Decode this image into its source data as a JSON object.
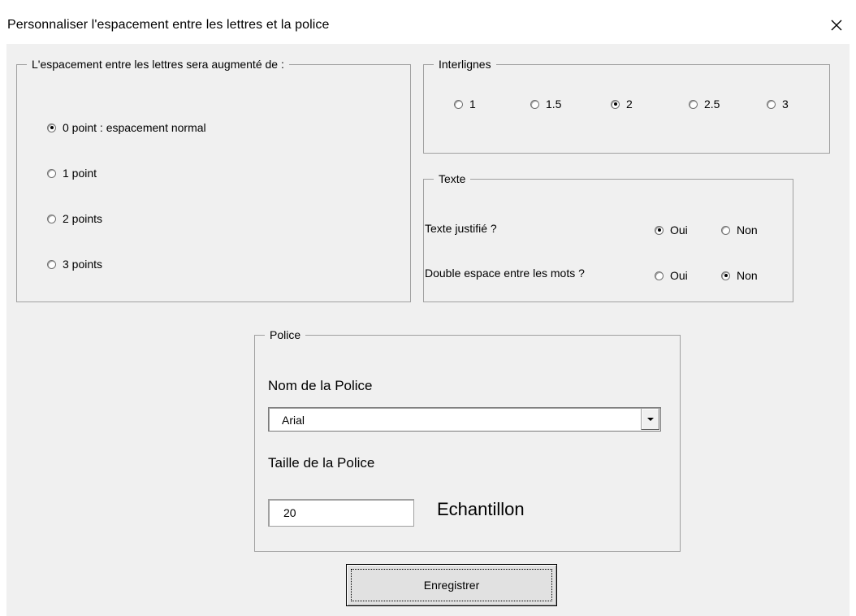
{
  "window": {
    "title": "Personnaliser l'espacement entre les lettres et la police",
    "close_icon": "close-icon"
  },
  "letter_spacing": {
    "legend": "L'espacement entre les lettres sera augmenté de :",
    "options": [
      {
        "label": "0 point : espacement normal",
        "selected": true
      },
      {
        "label": "1 point",
        "selected": false
      },
      {
        "label": "2 points",
        "selected": false
      },
      {
        "label": "3 points",
        "selected": false
      }
    ]
  },
  "line_spacing": {
    "legend": "Interlignes",
    "options": [
      {
        "label": "1",
        "selected": false
      },
      {
        "label": "1.5",
        "selected": false
      },
      {
        "label": "2",
        "selected": true
      },
      {
        "label": "2.5",
        "selected": false
      },
      {
        "label": "3",
        "selected": false
      }
    ]
  },
  "text": {
    "legend": "Texte",
    "justified": {
      "question": "Texte justifié ?",
      "yes": "Oui",
      "no": "Non",
      "value": "Oui"
    },
    "double_space": {
      "question": "Double espace entre les mots ?",
      "yes": "Oui",
      "no": "Non",
      "value": "Non"
    }
  },
  "font": {
    "legend": "Police",
    "name_label": "Nom de la Police",
    "name_value": "Arial",
    "size_label": "Taille de la Police",
    "size_value": "20",
    "sample_label": "Echantillon"
  },
  "save_button": "Enregistrer",
  "colors": {
    "dialog_bg": "#f0f0f0",
    "border": "#a0a0a0",
    "button_bg": "#e1e1e1"
  }
}
